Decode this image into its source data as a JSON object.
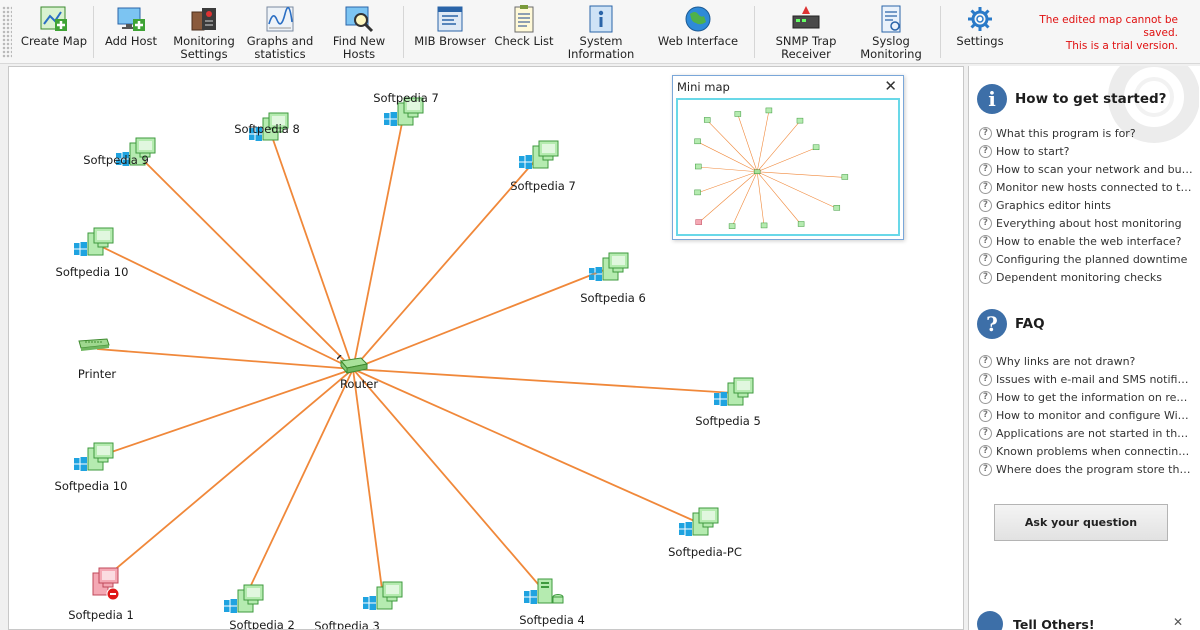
{
  "toolbar": {
    "buttons": [
      {
        "label": "Create Map",
        "icon": "create-map-icon"
      },
      {
        "label": "Add Host",
        "icon": "add-host-icon"
      },
      {
        "label": "Monitoring\nSettings",
        "icon": "monitoring-settings-icon"
      },
      {
        "label": "Graphs and\nstatistics",
        "icon": "graphs-icon"
      },
      {
        "label": "Find New\nHosts",
        "icon": "find-hosts-icon"
      },
      {
        "label": "MIB Browser",
        "icon": "mib-browser-icon"
      },
      {
        "label": "Check List",
        "icon": "check-list-icon"
      },
      {
        "label": "System\nInformation",
        "icon": "system-information-icon"
      },
      {
        "label": "Web Interface",
        "icon": "globe-icon"
      },
      {
        "label": "SNMP Trap\nReceiver",
        "icon": "snmp-trap-icon"
      },
      {
        "label": "Syslog\nMonitoring",
        "icon": "syslog-icon"
      },
      {
        "label": "Settings",
        "icon": "gear-icon"
      }
    ],
    "trial_notice": "The edited map cannot be saved.\nThis is a trial version."
  },
  "map": {
    "link_color": "#f0883a",
    "hub": {
      "label": "Router",
      "type": "router"
    },
    "nodes": [
      {
        "label": "Softpedia 9",
        "type": "pc",
        "os": "windows",
        "status": "up"
      },
      {
        "label": "Softpedia 8",
        "type": "pc",
        "os": "windows",
        "status": "up"
      },
      {
        "label": "Softpedia 7",
        "type": "pc",
        "os": "windows",
        "status": "up"
      },
      {
        "label": "Softpedia 7",
        "type": "pc",
        "os": "windows",
        "status": "up"
      },
      {
        "label": "Softpedia 10",
        "type": "pc",
        "os": "windows",
        "status": "up"
      },
      {
        "label": "Softpedia 6",
        "type": "pc",
        "os": "windows",
        "status": "up"
      },
      {
        "label": "Printer",
        "type": "printer",
        "os": "",
        "status": "up"
      },
      {
        "label": "Softpedia 5",
        "type": "pc",
        "os": "windows",
        "status": "up"
      },
      {
        "label": "Softpedia 10",
        "type": "pc",
        "os": "windows",
        "status": "up"
      },
      {
        "label": "Softpedia-PC",
        "type": "pc",
        "os": "windows",
        "status": "up"
      },
      {
        "label": "Softpedia 1",
        "type": "pc",
        "os": "",
        "status": "down"
      },
      {
        "label": "Softpedia 2",
        "type": "pc",
        "os": "windows",
        "status": "up"
      },
      {
        "label": "Softpedia 3",
        "type": "pc",
        "os": "windows",
        "status": "up"
      },
      {
        "label": "Softpedia 4",
        "type": "server",
        "os": "windows",
        "status": "up"
      }
    ]
  },
  "minimap": {
    "title": "Mini map",
    "close_symbol": "✕"
  },
  "panel": {
    "get_started": {
      "title": "How to get started?",
      "items": [
        "What this program is for?",
        "How to start?",
        "How to scan your network and build a map?",
        "Monitor new hosts connected to the network",
        "Graphics editor hints",
        "Everything about host monitoring",
        "How to enable the web interface?",
        "Configuring the planned downtime",
        "Dependent monitoring checks"
      ]
    },
    "faq": {
      "title": "FAQ",
      "items": [
        "Why links are not drawn?",
        "Issues with e-mail and SMS notifications",
        "How to get the information on remote hosts?",
        "How to monitor and configure Windows hosts?",
        "Applications are not started in the background",
        "Known problems when connecting to hosts",
        "Where does the program store the data?"
      ]
    },
    "ask_button": "Ask your question",
    "tell_others": "Tell Others!",
    "close_symbol": "✕"
  }
}
